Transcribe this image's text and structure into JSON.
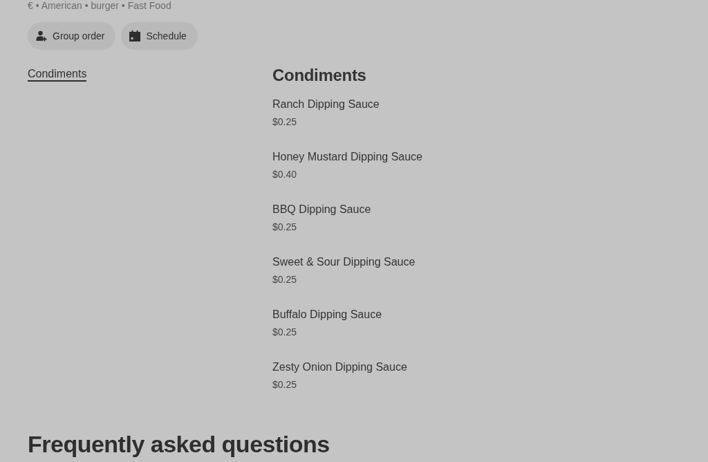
{
  "store": {
    "tags": "€ • American • burger • Fast Food"
  },
  "actions": [
    {
      "kind": "group",
      "label": "Group order"
    },
    {
      "kind": "schedule",
      "label": "Schedule"
    }
  ],
  "menu_nav": [
    {
      "label": "Condiments",
      "selected": true
    }
  ],
  "section": {
    "title": "Condiments",
    "items": [
      {
        "name": "Ranch Dipping Sauce",
        "price": "$0.25"
      },
      {
        "name": "Honey Mustard Dipping Sauce",
        "price": "$0.40"
      },
      {
        "name": "BBQ Dipping Sauce",
        "price": "$0.25"
      },
      {
        "name": "Sweet & Sour Dipping Sauce",
        "price": "$0.25"
      },
      {
        "name": "Buffalo Dipping Sauce",
        "price": "$0.25"
      },
      {
        "name": "Zesty Onion Dipping Sauce",
        "price": "$0.25"
      }
    ]
  },
  "faq": {
    "title": "Frequently asked questions"
  }
}
